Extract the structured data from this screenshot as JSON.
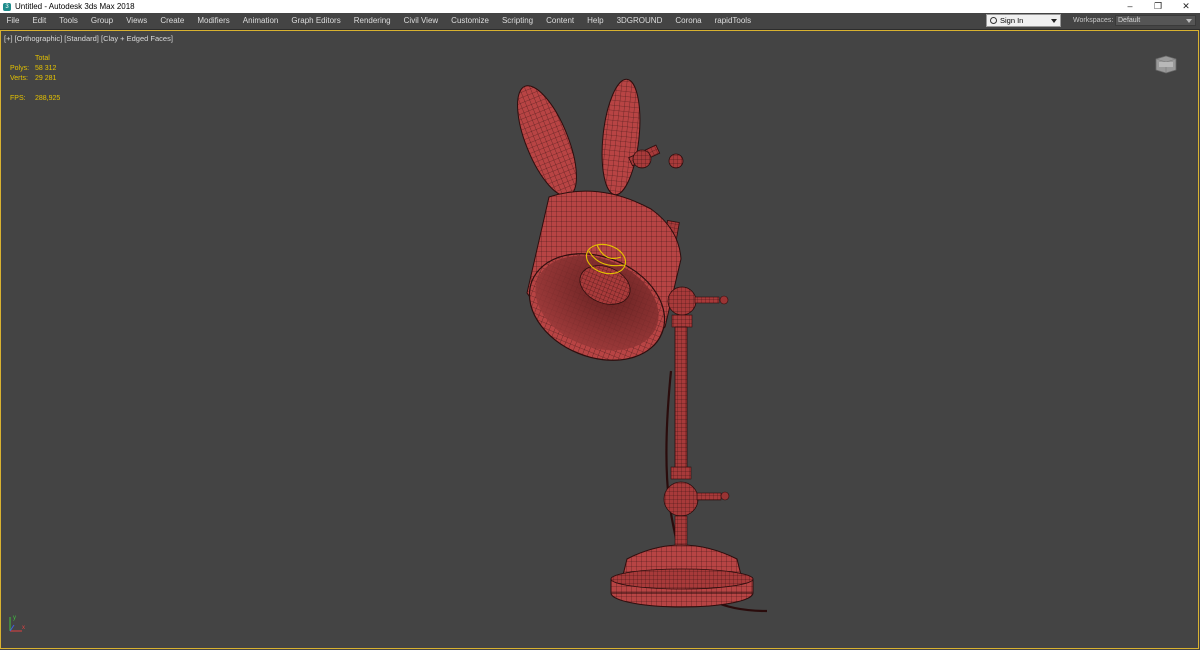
{
  "window": {
    "title": "Untitled - Autodesk 3ds Max 2018",
    "app_icon": "3ds-max-icon",
    "controls": [
      "minimize-icon",
      "restore-icon",
      "close-icon"
    ]
  },
  "menubar": {
    "items": [
      "File",
      "Edit",
      "Tools",
      "Group",
      "Views",
      "Create",
      "Modifiers",
      "Animation",
      "Graph Editors",
      "Rendering",
      "Civil View",
      "Customize",
      "Scripting",
      "Content",
      "Help",
      "3DGROUND",
      "Corona",
      "rapidTools"
    ]
  },
  "account": {
    "sign_in": "Sign In",
    "workspaces_label": "Workspaces:",
    "workspace_value": "Default"
  },
  "viewport": {
    "label_parts": [
      "[+]",
      "[Orthographic]",
      "[Standard]",
      "[Clay + Edged Faces]"
    ],
    "stats": {
      "header": "Total",
      "polys_label": "Polys:",
      "polys_value": "58 312",
      "verts_label": "Verts:",
      "verts_value": "29 281",
      "fps_label": "FPS:",
      "fps_value": "288,925"
    },
    "axis_labels": {
      "y": "y",
      "x": "x"
    },
    "object": "rabbit-desk-lamp-mesh"
  },
  "colors": {
    "viewport_bg": "#444444",
    "viewport_border": "#d9b230",
    "mesh_fill": "#b84444",
    "wire": "#3a1414",
    "selection": "#e4c200",
    "stats_text": "#e4c200"
  }
}
